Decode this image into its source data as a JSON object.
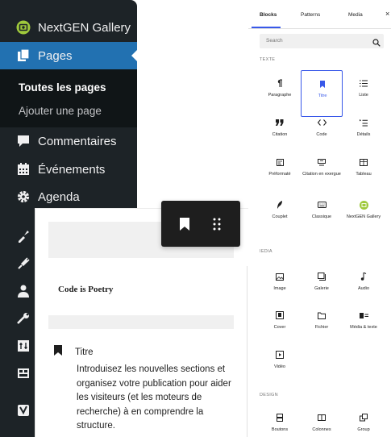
{
  "sidebar": {
    "items": [
      {
        "label": "NextGEN Gallery",
        "icon": "nextgen-icon"
      },
      {
        "label": "Pages",
        "icon": "pages-icon",
        "current": true
      },
      {
        "label": "Commentaires",
        "icon": "comments-icon"
      },
      {
        "label": "Événements",
        "icon": "calendar-icon"
      },
      {
        "label": "Agenda",
        "icon": "gear-icon"
      }
    ],
    "submenu": {
      "current": "Toutes les pages",
      "other": "Ajouter une page"
    },
    "icons_only": [
      "appearance-icon",
      "plugins-icon",
      "users-icon",
      "tools-icon",
      "settings-icon",
      "widget-icon",
      "yoast-icon"
    ]
  },
  "editor": {
    "preview_text": "Code is Poetry",
    "block_title": "Titre",
    "block_description": "Introduisez les nouvelles sections et organisez votre publication pour aider les visiteurs (et les moteurs de recherche) à en comprendre la structure."
  },
  "inserter": {
    "tabs": [
      "Blocks",
      "Patterns",
      "Media"
    ],
    "active_tab": "Blocks",
    "close_label": "×",
    "search_placeholder": "Search",
    "categories": [
      {
        "label": "TEXTE",
        "blocks": [
          {
            "label": "Paragraphe",
            "icon": "paragraph-icon"
          },
          {
            "label": "Titre",
            "icon": "heading-icon",
            "selected": true
          },
          {
            "label": "Liste",
            "icon": "list-icon"
          },
          {
            "label": "Citation",
            "icon": "quote-icon"
          },
          {
            "label": "Code",
            "icon": "code-icon"
          },
          {
            "label": "Détails",
            "icon": "details-icon"
          },
          {
            "label": "Préformaté",
            "icon": "preformatted-icon"
          },
          {
            "label": "Citation en exergue",
            "icon": "pullquote-icon"
          },
          {
            "label": "Tableau",
            "icon": "table-icon"
          },
          {
            "label": "Couplet",
            "icon": "verse-icon"
          },
          {
            "label": "Classique",
            "icon": "classic-icon"
          },
          {
            "label": "NextGEN Gallery",
            "icon": "nextgen-block-icon"
          }
        ]
      },
      {
        "label": "IEDIA",
        "blocks": [
          {
            "label": "Image",
            "icon": "image-icon"
          },
          {
            "label": "Galerie",
            "icon": "gallery-icon"
          },
          {
            "label": "Audio",
            "icon": "audio-icon"
          },
          {
            "label": "Cover",
            "icon": "cover-icon"
          },
          {
            "label": "Fichier",
            "icon": "file-icon"
          },
          {
            "label": "Média & texte",
            "icon": "media-text-icon"
          },
          {
            "label": "Vidéo",
            "icon": "video-icon"
          }
        ]
      },
      {
        "label": "DESIGN",
        "blocks": [
          {
            "label": "Boutons",
            "icon": "buttons-icon"
          },
          {
            "label": "Colonnes",
            "icon": "columns-icon"
          },
          {
            "label": "Group",
            "icon": "group-icon"
          }
        ]
      }
    ]
  },
  "colors": {
    "admin_bg": "#1d2327",
    "admin_current": "#2271b1",
    "accent": "#3858e9",
    "nextgen_green": "#9fc93c"
  }
}
